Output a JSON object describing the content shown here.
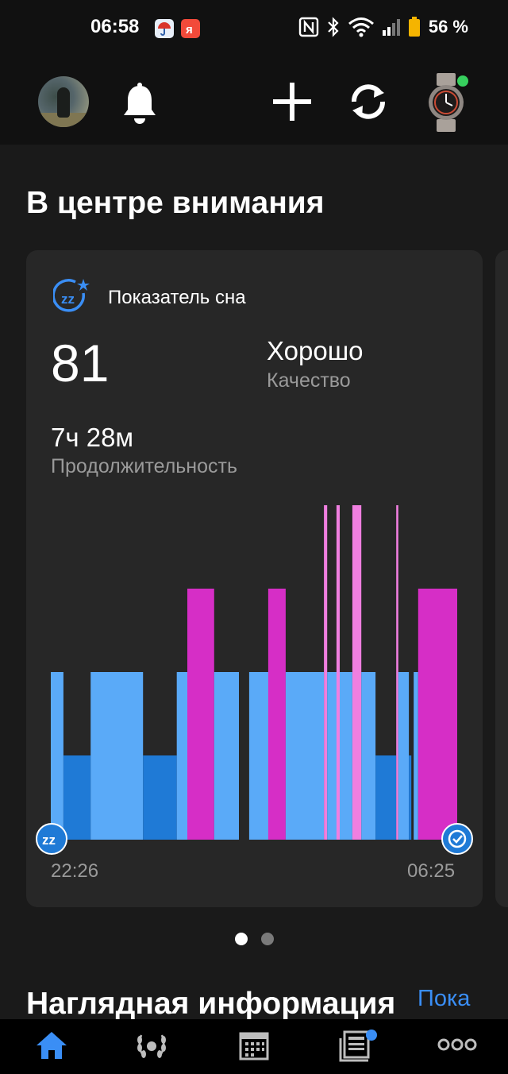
{
  "status_bar": {
    "time": "06:58",
    "battery": "56 %",
    "app_icons": [
      "umbrella-app-icon",
      "yandex-app-icon"
    ],
    "system_icons": [
      "nfc-icon",
      "bluetooth-icon",
      "wifi-icon",
      "signal-icon",
      "battery-icon"
    ]
  },
  "top_bar": {
    "icons": [
      "avatar",
      "bell-icon",
      "plus-icon",
      "sync-icon",
      "watch-icon"
    ],
    "device_status_color": "#37d05e"
  },
  "section": {
    "title": "В центре внимания"
  },
  "sleep_card": {
    "header": "Показатель сна",
    "score": "81",
    "quality_value": "Хорошо",
    "quality_label": "Качество",
    "duration_value": "7ч 28м",
    "duration_label": "Продолжительность",
    "start_time": "22:26",
    "end_time": "06:25",
    "start_icon": "sleep-zz-icon",
    "end_icon": "wake-clock-icon"
  },
  "chart_data": {
    "type": "bar",
    "title": "",
    "x_start": "22:26",
    "x_end": "06:25",
    "levels": [
      "deep",
      "light",
      "rem",
      "awake"
    ],
    "colors": {
      "deep": "#1f7ad6",
      "light": "#5aaaf8",
      "rem": "#d62ec6",
      "awake": "#f07fe0"
    },
    "stages": [
      {
        "stage": "light",
        "start": 0.0,
        "end": 0.031
      },
      {
        "stage": "deep",
        "start": 0.031,
        "end": 0.098
      },
      {
        "stage": "light",
        "start": 0.098,
        "end": 0.227
      },
      {
        "stage": "deep",
        "start": 0.227,
        "end": 0.31
      },
      {
        "stage": "light",
        "start": 0.31,
        "end": 0.336
      },
      {
        "stage": "rem",
        "start": 0.336,
        "end": 0.402
      },
      {
        "stage": "light",
        "start": 0.402,
        "end": 0.463
      },
      {
        "stage": "light",
        "start": 0.488,
        "end": 0.535
      },
      {
        "stage": "rem",
        "start": 0.535,
        "end": 0.578
      },
      {
        "stage": "light",
        "start": 0.578,
        "end": 0.672
      },
      {
        "stage": "awake",
        "start": 0.672,
        "end": 0.68
      },
      {
        "stage": "light",
        "start": 0.68,
        "end": 0.703
      },
      {
        "stage": "awake",
        "start": 0.703,
        "end": 0.711
      },
      {
        "stage": "light",
        "start": 0.711,
        "end": 0.742
      },
      {
        "stage": "awake",
        "start": 0.742,
        "end": 0.764
      },
      {
        "stage": "light",
        "start": 0.764,
        "end": 0.799
      },
      {
        "stage": "deep",
        "start": 0.799,
        "end": 0.85
      },
      {
        "stage": "awake",
        "start": 0.85,
        "end": 0.855
      },
      {
        "stage": "light",
        "start": 0.855,
        "end": 0.881
      },
      {
        "stage": "deep",
        "start": 0.881,
        "end": 0.887
      },
      {
        "stage": "light",
        "start": 0.893,
        "end": 0.904
      },
      {
        "stage": "rem",
        "start": 0.904,
        "end": 1.0
      }
    ]
  },
  "carousel": {
    "pages": 2,
    "active": 0
  },
  "section2": {
    "title": "Наглядная информация",
    "link": "Пока"
  },
  "bottom_nav": {
    "items": [
      "home-icon",
      "challenges-laurel-icon",
      "calendar-icon",
      "news-icon",
      "more-icon"
    ],
    "active": "home-icon",
    "accent": "#3a8ef5"
  }
}
